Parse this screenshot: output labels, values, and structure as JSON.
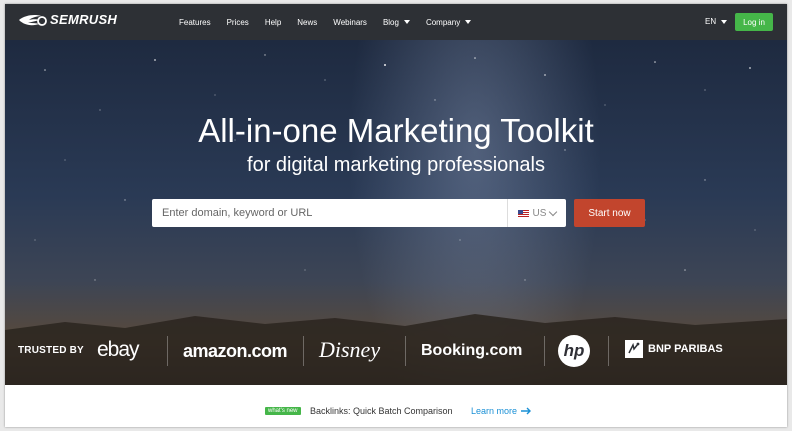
{
  "nav": {
    "logo_text": "SEMRUSH",
    "items": [
      {
        "label": "Features"
      },
      {
        "label": "Prices"
      },
      {
        "label": "Help"
      },
      {
        "label": "News"
      },
      {
        "label": "Webinars"
      },
      {
        "label": "Blog"
      },
      {
        "label": "Company"
      }
    ],
    "lang": "EN",
    "login": "Log in"
  },
  "hero": {
    "headline": "All-in-one Marketing Toolkit",
    "subline": "for digital marketing professionals",
    "search_placeholder": "Enter domain, keyword or URL",
    "country": "US",
    "start_button": "Start now"
  },
  "trusted": {
    "label": "TRUSTED BY",
    "brands": [
      "ebay",
      "amazon.com",
      "Disney",
      "Booking.com",
      "hp",
      "BNP PARIBAS"
    ]
  },
  "bottom": {
    "badge": "what's new",
    "text": "Backlinks: Quick Batch Comparison",
    "link": "Learn more"
  },
  "colors": {
    "nav_bg": "#2d3035",
    "login_green": "#45b649",
    "start_orange": "#c2452d",
    "link_blue": "#1a90d6"
  }
}
